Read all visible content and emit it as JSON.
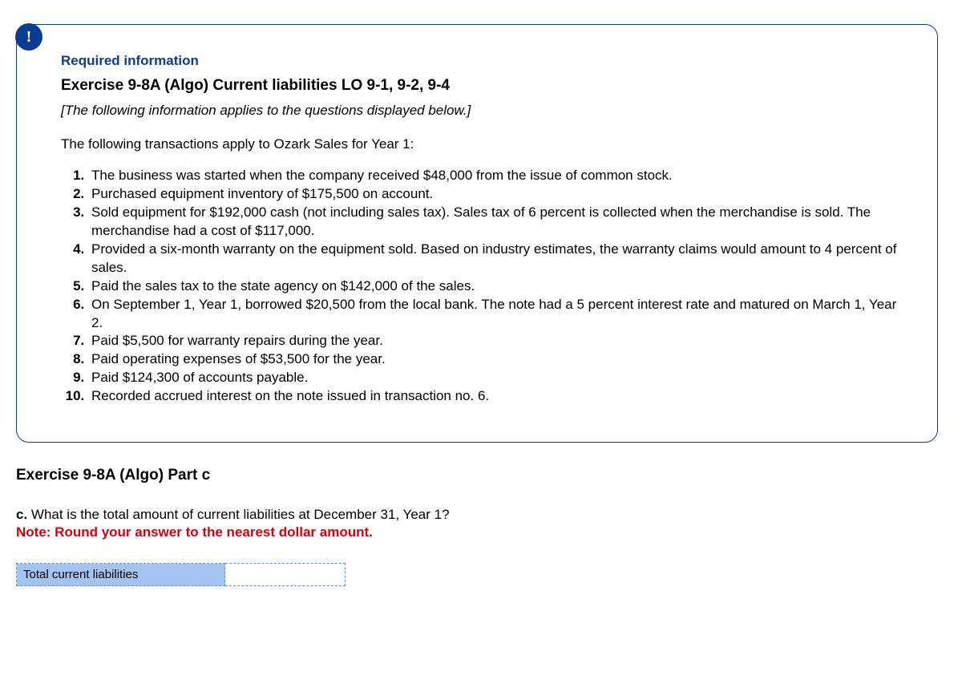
{
  "info_box": {
    "badge": "!",
    "required_label": "Required information",
    "exercise_title": "Exercise 9-8A (Algo) Current liabilities LO 9-1, 9-2, 9-4",
    "italic_note": "[The following information applies to the questions displayed below.]",
    "intro": "The following transactions apply to Ozark Sales for Year 1:",
    "transactions": [
      "The business was started when the company received $48,000 from the issue of common stock.",
      "Purchased equipment inventory of $175,500 on account.",
      "Sold equipment for $192,000 cash (not including sales tax). Sales tax of 6 percent is collected when the merchandise is sold. The merchandise had a cost of $117,000.",
      "Provided a six-month warranty on the equipment sold. Based on industry estimates, the warranty claims would amount to 4 percent of sales.",
      "Paid the sales tax to the state agency on $142,000 of the sales.",
      "On September 1, Year 1, borrowed $20,500 from the local bank. The note had a 5 percent interest rate and matured on March 1, Year 2.",
      "Paid $5,500 for warranty repairs during the year.",
      "Paid operating expenses of $53,500 for the year.",
      "Paid $124,300 of accounts payable.",
      "Recorded accrued interest on the note issued in transaction no. 6."
    ]
  },
  "part": {
    "title": "Exercise 9-8A (Algo) Part c",
    "question_letter": "c.",
    "question_text": " What is the total amount of current liabilities at December 31, Year 1?",
    "note_label": "Note: Round your answer to the nearest dollar amount.",
    "answer_label": "Total current liabilities",
    "answer_value": ""
  }
}
